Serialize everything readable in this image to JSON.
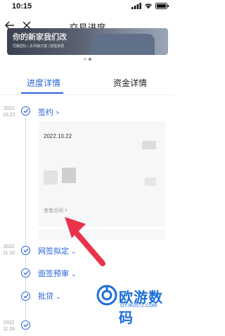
{
  "status": {
    "time": "10:15"
  },
  "nav": {
    "title": "交易进度"
  },
  "banner": {
    "text": "你的新家我们改",
    "subtext": "同策团队 | 多风格方案 | 智能家居"
  },
  "tabs": [
    {
      "label": "进度详情"
    },
    {
      "label": "资金详情"
    }
  ],
  "timeline": [
    {
      "date_year": "2022",
      "date_day": "10.22",
      "label": "签约",
      "chevron": ">"
    },
    {
      "date_year": "2022",
      "date_day": "11.10",
      "label": "网签拟定",
      "chevron": "⌄"
    },
    {
      "date_year": "",
      "date_day": "",
      "label": "面签预审",
      "chevron": "⌄"
    },
    {
      "date_year": "",
      "date_day": "",
      "label": "批贷",
      "chevron": "⌄"
    },
    {
      "date_year": "2022",
      "date_day": "11.18",
      "label": "",
      "chevron": ""
    }
  ],
  "card": {
    "date": "2022.10.22",
    "view_contract": "查看合同 >"
  },
  "watermark": {
    "text": "欧游数码",
    "sub": "OYJK0572.COM"
  },
  "colors": {
    "accent": "#2b63d9",
    "arrow": "#e8334a"
  }
}
